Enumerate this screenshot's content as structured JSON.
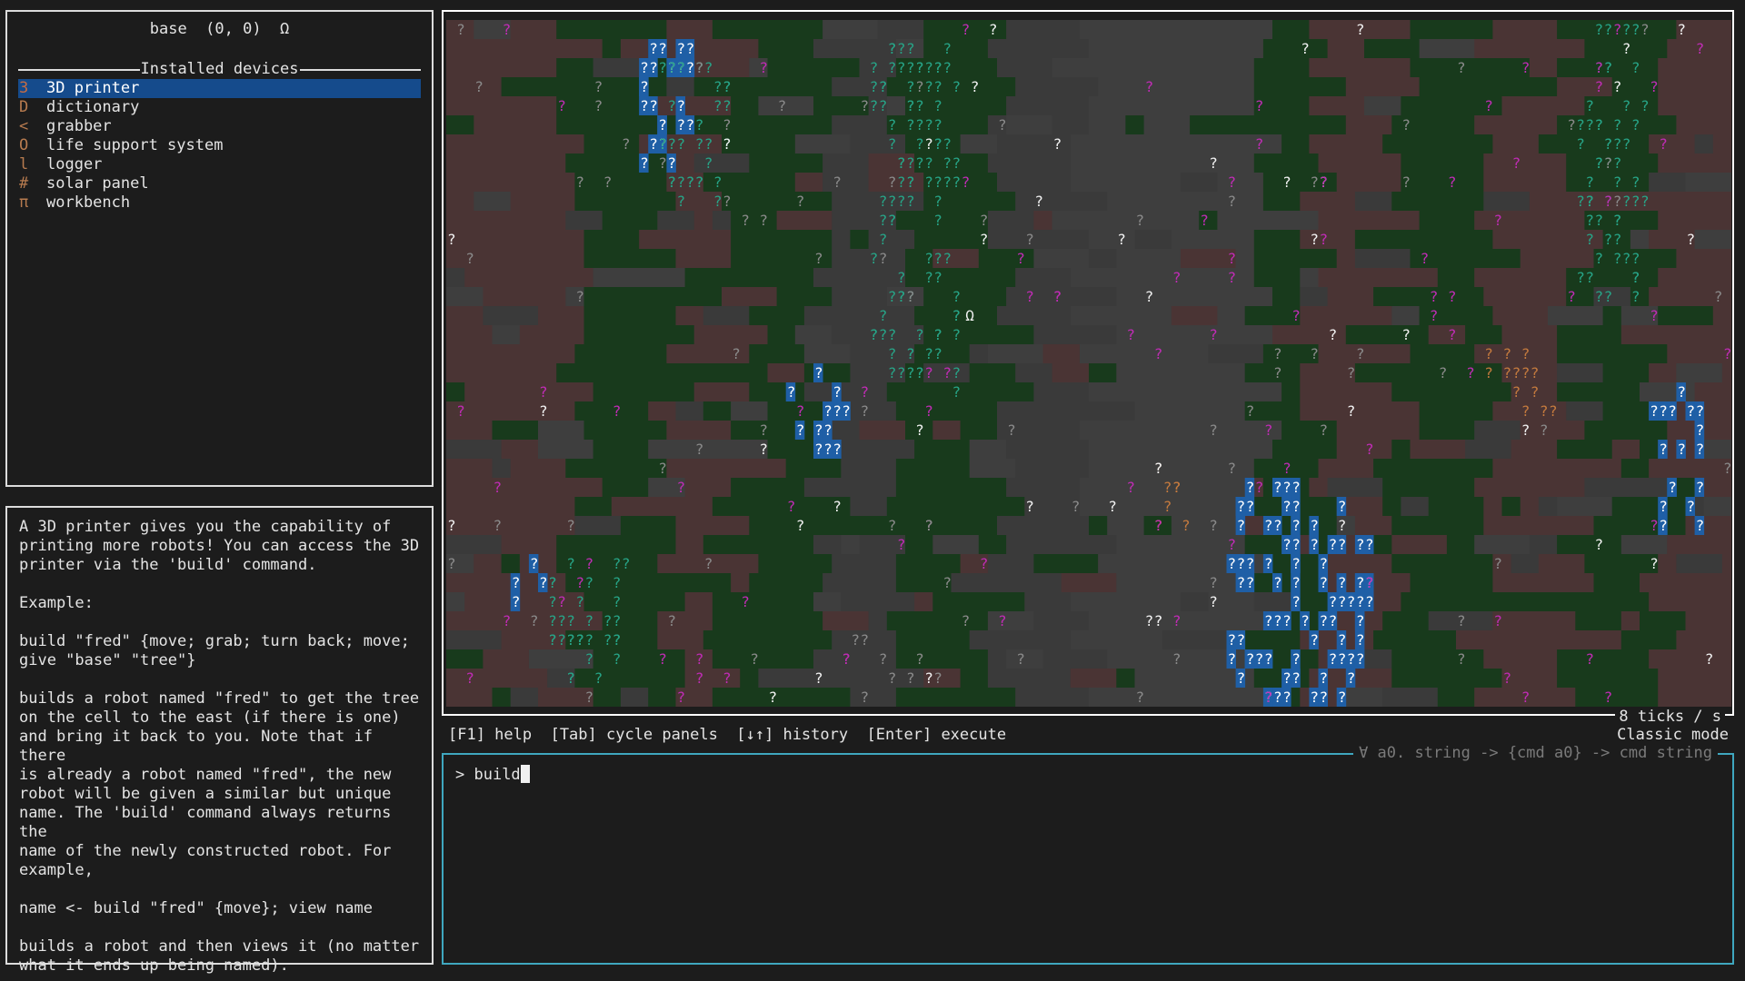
{
  "robot_panel": {
    "header": "base  (0, 0)  Ω",
    "section_title": "Installed devices",
    "devices": [
      {
        "glyph": "3",
        "name": "3D printer",
        "glyph_color": "#c46c45",
        "selected": true
      },
      {
        "glyph": "D",
        "name": "dictionary",
        "glyph_color": "#b77b4f"
      },
      {
        "glyph": "<",
        "name": "grabber",
        "glyph_color": "#b77b4f"
      },
      {
        "glyph": "O",
        "name": "life support system",
        "glyph_color": "#b77b4f"
      },
      {
        "glyph": "l",
        "name": "logger",
        "glyph_color": "#b77b4f"
      },
      {
        "glyph": "#",
        "name": "solar panel",
        "glyph_color": "#b77b4f"
      },
      {
        "glyph": "π",
        "name": "workbench",
        "glyph_color": "#b77b4f"
      }
    ]
  },
  "info_panel": {
    "text": "A 3D printer gives you the capability of\nprinting more robots! You can access the 3D\nprinter via the 'build' command.\n\nExample:\n\nbuild \"fred\" {move; grab; turn back; move;\ngive \"base\" \"tree\"}\n\nbuilds a robot named \"fred\" to get the tree\non the cell to the east (if there is one)\nand bring it back to you. Note that if there\nis already a robot named \"fred\", the new\nrobot will be given a similar but unique\nname. The 'build' command always returns the\nname of the newly constructed robot. For\nexample,\n\nname <- build \"fred\" {move}; view name\n\nbuilds a robot and then views it (no matter\nwhat it ends up being named)."
  },
  "world": {
    "unknown_glyph": "?",
    "base_glyph": "Ω",
    "ticks_label": "8 ticks / s",
    "colors": {
      "forest": "#183a1c",
      "ground": "#3a3a3a",
      "rock": "#3e3e3e",
      "dirt": "#4a3434",
      "blue": "#1f5fa6",
      "teal": "#27a487",
      "magenta": "#c02cb5",
      "orange": "#c47a3e",
      "gray": "#8a8a8a",
      "white": "#f2f2f2"
    }
  },
  "keybar": {
    "text": "[F1] help  [Tab] cycle panels  [↓↑] history  [Enter] execute",
    "mode": "Classic mode"
  },
  "repl": {
    "type_signature": "∀ a0. string -> {cmd a0} -> cmd string",
    "prompt": "> ",
    "input_value": "build"
  }
}
